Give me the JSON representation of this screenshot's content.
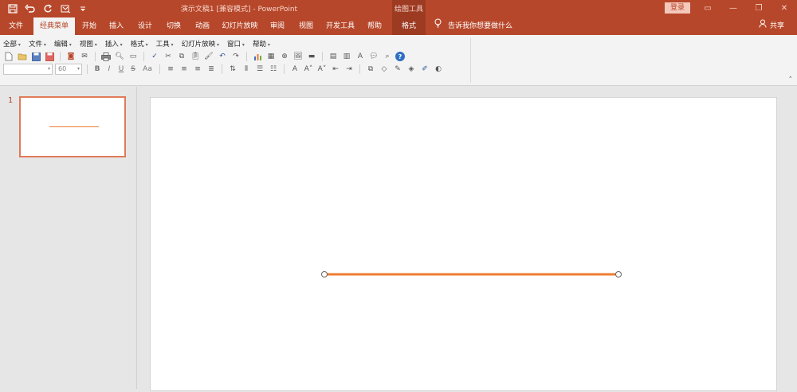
{
  "titlebar": {
    "document_title": "演示文稿1 [兼容模式] - PowerPoint",
    "context_group": "绘图工具",
    "login_label": "登录",
    "qat_icons": [
      "save-icon",
      "undo-icon",
      "redo-icon",
      "customize-icon",
      "qat-dropdown-icon"
    ]
  },
  "tabs": [
    {
      "label": "文件"
    },
    {
      "label": "经典菜单"
    },
    {
      "label": "开始"
    },
    {
      "label": "插入"
    },
    {
      "label": "设计"
    },
    {
      "label": "切换"
    },
    {
      "label": "动画"
    },
    {
      "label": "幻灯片放映"
    },
    {
      "label": "审阅"
    },
    {
      "label": "视图"
    },
    {
      "label": "开发工具"
    },
    {
      "label": "帮助"
    },
    {
      "label": "格式"
    }
  ],
  "active_tab": "经典菜单",
  "tell_me": "告诉我你想要做什么",
  "share_label": "共享",
  "classic_menu": [
    "全部",
    "文件",
    "编辑",
    "视图",
    "插入",
    "格式",
    "工具",
    "幻灯片放映",
    "窗口",
    "帮助"
  ],
  "font": {
    "name_value": "",
    "size_value": "60"
  },
  "format_buttons": [
    "B",
    "I",
    "U",
    "S",
    "Aa"
  ],
  "thumbnails": [
    {
      "number": "1"
    }
  ],
  "colors": {
    "accent": "#b7472a",
    "line": "#ed7d31",
    "selection": "#e07a5a"
  }
}
